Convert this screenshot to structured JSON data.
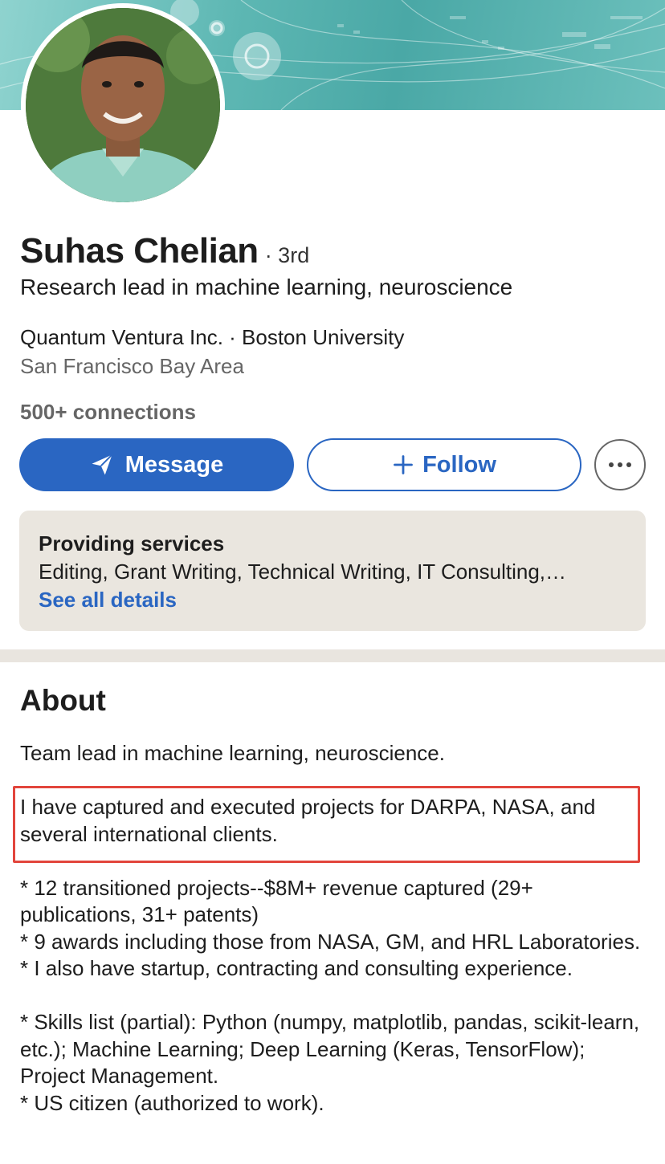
{
  "profile": {
    "name": "Suhas Chelian",
    "degree": "· 3rd",
    "headline": "Research lead in machine learning, neuroscience",
    "company_line": "Quantum Ventura Inc. · Boston University",
    "location": "San Francisco Bay Area",
    "connections": "500+ connections"
  },
  "actions": {
    "message_label": "Message",
    "follow_label": "Follow",
    "more_icon": "more-horizontal-icon"
  },
  "services": {
    "title": "Providing services",
    "list": "Editing, Grant Writing, Technical Writing, IT Consulting,…",
    "link": "See all details"
  },
  "about": {
    "title": "About",
    "para1": "Team lead in machine learning, neuroscience.",
    "para2": "I have captured and executed projects for DARPA, NASA, and several international clients.",
    "bullet1": "* 12 transitioned projects--$8M+ revenue captured (29+ publications, 31+ patents)",
    "bullet2": "* 9 awards including those from NASA, GM, and HRL Laboratories.",
    "bullet3": "* I also have startup, contracting and consulting experience.",
    "bullet4": "* Skills list (partial): Python (numpy, matplotlib, pandas, scikit-learn, etc.); Machine Learning; Deep Learning (Keras, TensorFlow); Project Management.",
    "bullet5": "* US citizen (authorized to work)."
  },
  "colors": {
    "brand_blue": "#2a66c2",
    "highlight_red": "#e2453c",
    "banner_teal": "#5db7b3"
  }
}
